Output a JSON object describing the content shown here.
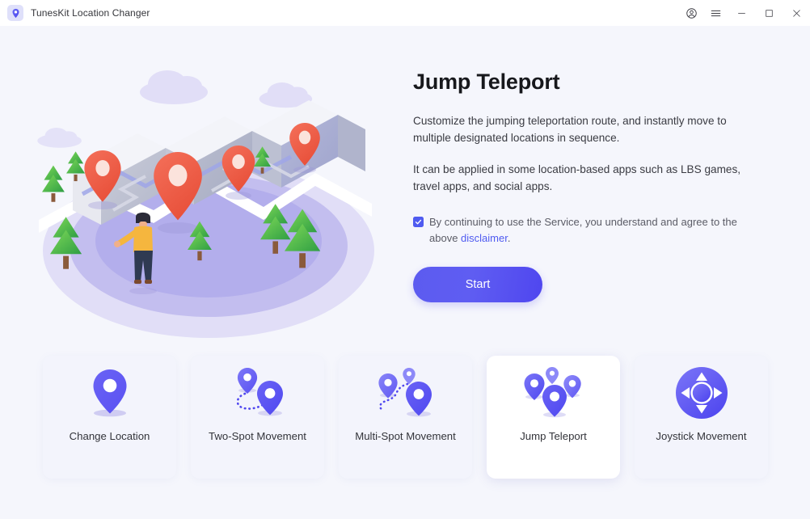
{
  "window": {
    "app_title": "TunesKit Location Changer",
    "logo_icon": "location-pin-app-icon",
    "controls": {
      "account": "account-circle-icon",
      "menu": "hamburger-menu-icon",
      "minimize": "minimize-icon",
      "maximize": "maximize-icon",
      "close": "close-icon"
    }
  },
  "illustration": {
    "name": "isometric-map-with-route-pins-illustration",
    "description": "Isometric folded map on purple ellipse with red location pins, pine trees, clouds and a person in a yellow shirt"
  },
  "panel": {
    "title": "Jump Teleport",
    "paragraph1": "Customize the jumping teleportation route, and instantly move to multiple designated locations in sequence.",
    "paragraph2": "It can be applied in some location-based apps such as LBS games, travel apps, and social apps.",
    "consent": {
      "checked": true,
      "text_before": "By continuing to use the Service, you understand and agree to the above ",
      "link_text": "disclaimer",
      "text_after": "."
    },
    "start_label": "Start"
  },
  "modes": {
    "selected_index": 3,
    "cards": [
      {
        "label": "Change Location",
        "icon": "single-pin-icon",
        "name": "mode-card-change-location"
      },
      {
        "label": "Two-Spot Movement",
        "icon": "two-pin-route-icon",
        "name": "mode-card-two-spot-movement"
      },
      {
        "label": "Multi-Spot Movement",
        "icon": "multi-pin-route-icon",
        "name": "mode-card-multi-spot-movement"
      },
      {
        "label": "Jump Teleport",
        "icon": "four-pin-scatter-icon",
        "name": "mode-card-jump-teleport"
      },
      {
        "label": "Joystick Movement",
        "icon": "joystick-dpad-icon",
        "name": "mode-card-joystick-movement"
      }
    ]
  },
  "colors": {
    "page_background": "#f5f6fc",
    "titlebar_background": "#ffffff",
    "accent": "#4f5bf0",
    "accent_gradient_start": "#5c5bf0",
    "accent_gradient_end": "#4f46ef",
    "card_background": "#f3f4fc",
    "card_selected_background": "#ffffff",
    "pin_red": "#ef5a42",
    "text_primary": "#17181c",
    "text_body": "#3a3b42",
    "text_muted": "#5b5c66"
  }
}
